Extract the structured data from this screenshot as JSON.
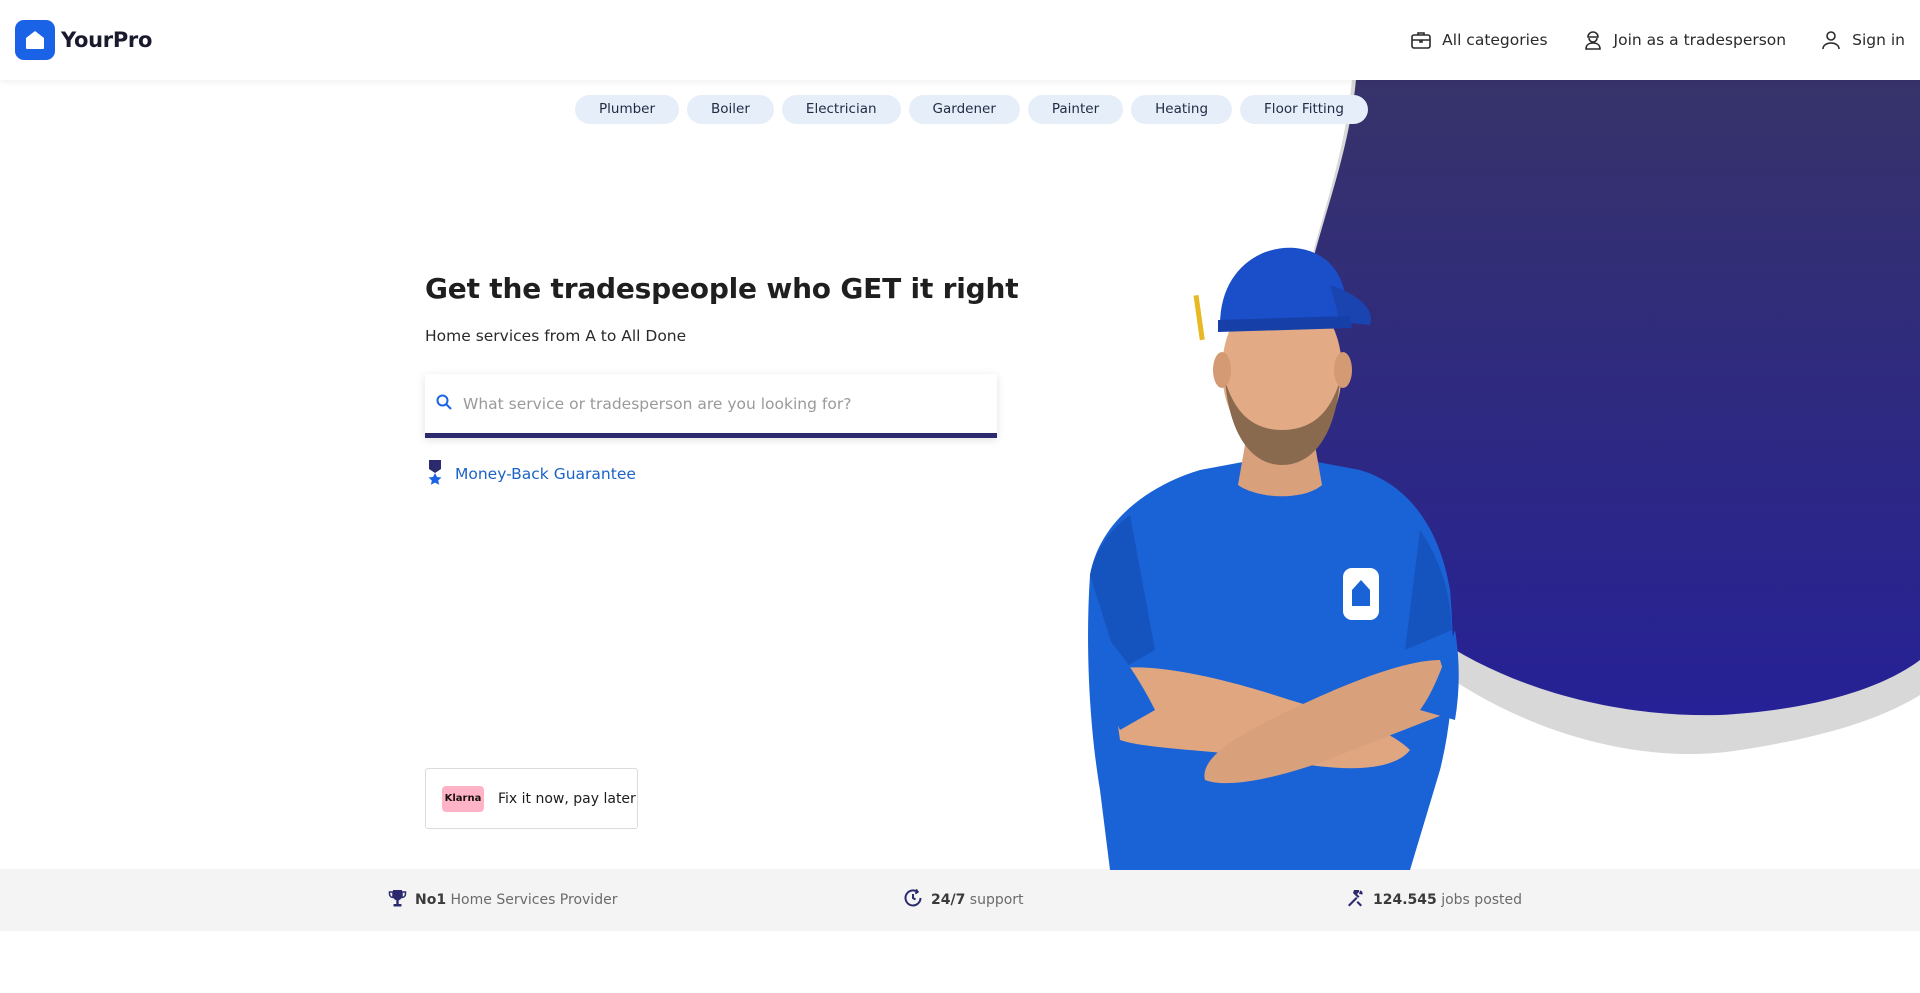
{
  "brand": {
    "name": "YourPro",
    "color": "#1b63e6"
  },
  "nav": {
    "categories": "All categories",
    "join": "Join as a tradesperson",
    "signin": "Sign in"
  },
  "chips": [
    "Plumber",
    "Boiler",
    "Electrician",
    "Gardener",
    "Painter",
    "Heating",
    "Floor Fitting"
  ],
  "hero": {
    "headline": "Get the tradespeople who GET it right",
    "subhead": "Home services from A to All Done",
    "search_placeholder": "What service or tradesperson are you looking for?",
    "guarantee": "Money-Back Guarantee"
  },
  "klarna": {
    "logo": "Klarna",
    "text": "Fix it now, pay later"
  },
  "stats": {
    "provider_strong": "No1",
    "provider_rest": "Home Services Provider",
    "support_strong": "24/7",
    "support_rest": "support",
    "jobs_strong": "124.545",
    "jobs_rest": "jobs posted"
  },
  "colors": {
    "accent": "#1b63e6",
    "navy": "#2b2a6e",
    "link": "#1b63c6",
    "chip_bg": "#e6eef9"
  }
}
